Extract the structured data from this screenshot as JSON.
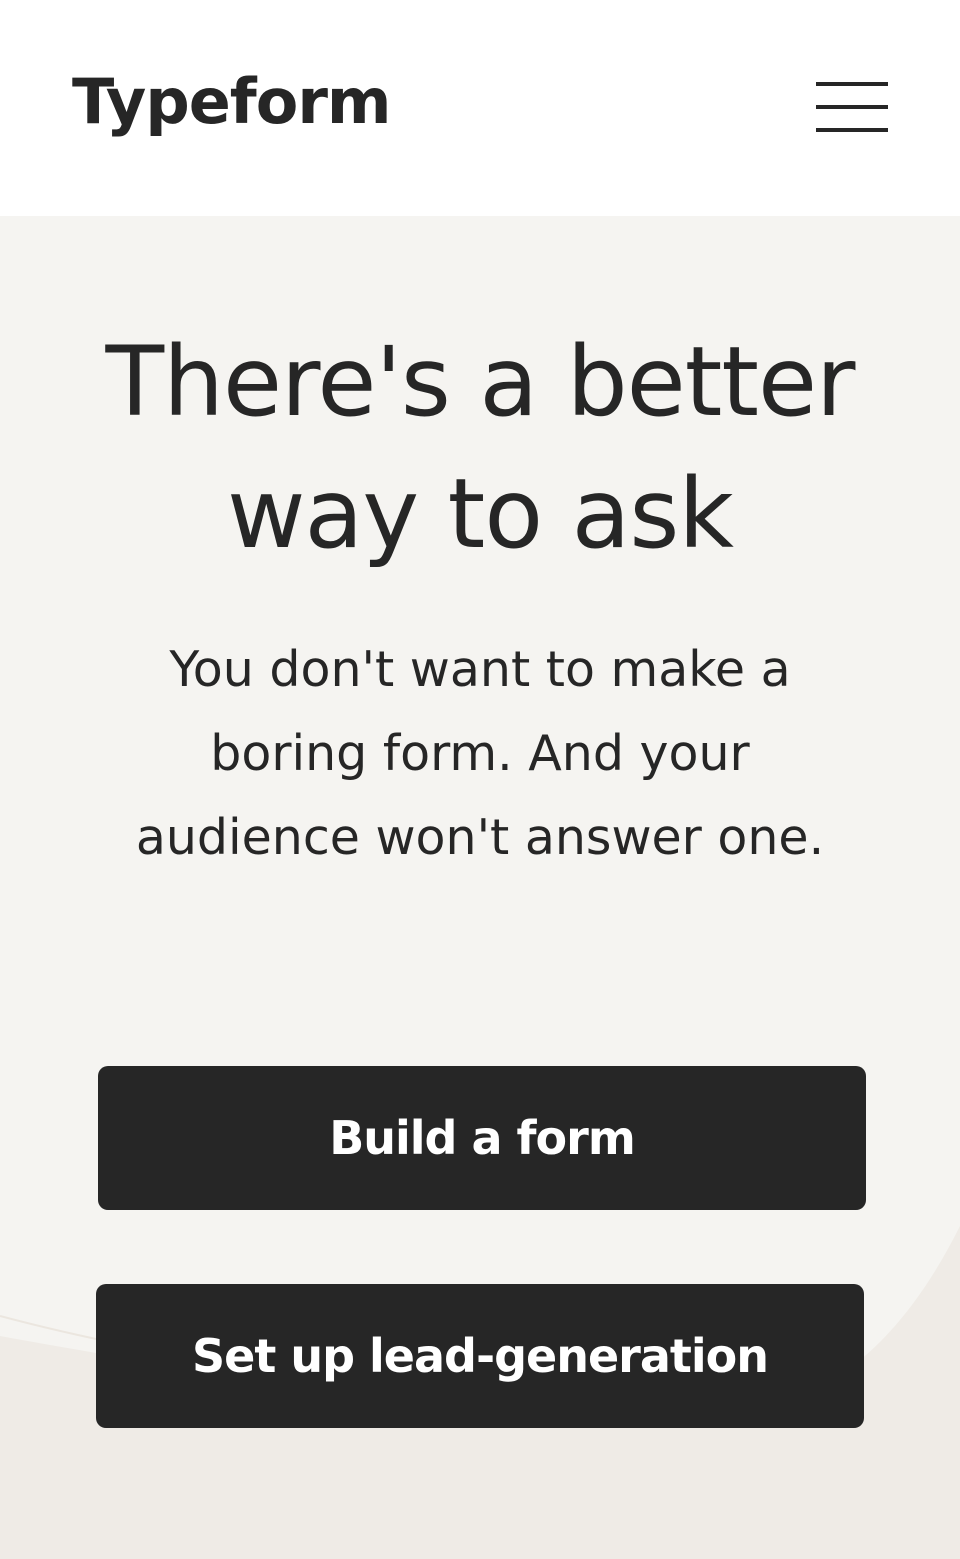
{
  "header": {
    "logo_text": "Typeform",
    "menu_icon": "hamburger-menu-icon"
  },
  "hero": {
    "headline": "There's a better way to ask",
    "subtext": "You don't want to make a boring form. And your audience won't answer one.",
    "buttons": [
      {
        "label": "Build a form"
      },
      {
        "label": "Set up lead-generation"
      }
    ]
  },
  "colors": {
    "header_bg": "#ffffff",
    "hero_bg": "#f5f4f1",
    "button_bg": "#262626",
    "button_text": "#ffffff",
    "text": "#262626"
  }
}
